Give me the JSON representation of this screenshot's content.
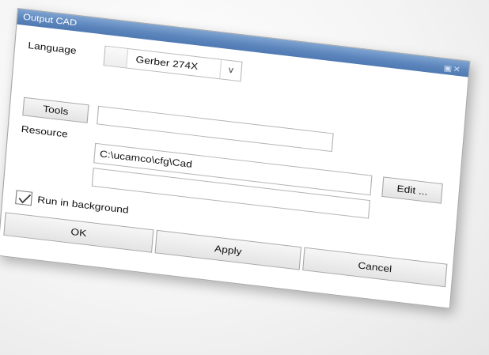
{
  "window": {
    "title": "Output CAD",
    "controls": "▣✕"
  },
  "language": {
    "label": "Language",
    "selected": "Gerber 274X"
  },
  "tools": {
    "button_label": "Tools",
    "value": ""
  },
  "resource": {
    "label": "Resource",
    "path": "C:\\ucamco\\cfg\\Cad",
    "extra_value": "",
    "edit_label": "Edit ..."
  },
  "options": {
    "run_in_background_label": "Run in background",
    "run_in_background_checked": true
  },
  "actions": {
    "ok_label": "OK",
    "apply_label": "Apply",
    "cancel_label": "Cancel"
  }
}
